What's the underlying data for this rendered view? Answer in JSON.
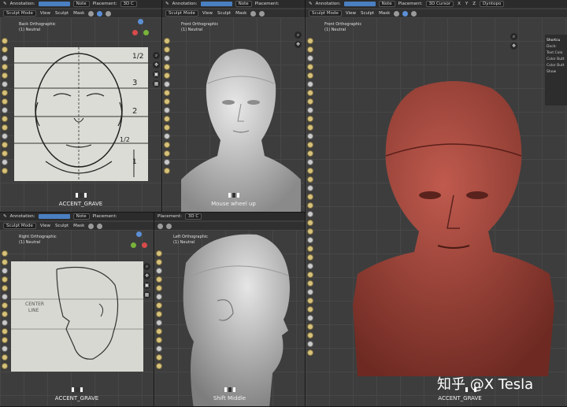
{
  "header": {
    "annotation_label": "Annotation:",
    "note_label": "Note",
    "placement_label": "Placement:",
    "placement_value": "3D Cursor",
    "placement_value_short": "3D C",
    "mode": "Sculpt Mode",
    "menu": [
      "View",
      "Sculpt",
      "Mask"
    ],
    "axis_x": "X",
    "axis_y": "Y",
    "axis_z": "Z",
    "dyntopo": "Dyntopo"
  },
  "viewports": {
    "back": {
      "ortho": "Back Orthographic",
      "collection": "(1) Neutral",
      "key": "ACCENT_GRAVE"
    },
    "front": {
      "ortho": "Front Orthographic",
      "collection": "(1) Neutral",
      "key": "Mouse wheel up"
    },
    "right": {
      "ortho": "Right Orthographic",
      "collection": "(1) Neutral",
      "key": "ACCENT_GRAVE"
    },
    "left": {
      "ortho": "Left Orthographic",
      "collection": "(1) Neutral",
      "key": "Shift Middle"
    },
    "main": {
      "ortho": "Front Orthographic",
      "collection": "(1) Neutral",
      "key": "ACCENT_GRAVE"
    }
  },
  "sketch": {
    "marks": [
      "1/2",
      "3",
      "2",
      "1/2",
      "1"
    ],
    "side_labels": [
      "CENTER",
      "LINE"
    ]
  },
  "npanel": {
    "title": "Shortcu",
    "dock": "Dock:",
    "text_color": "Text Colo",
    "color_button": "Color Butt",
    "color_button2": "Color Butt",
    "show": "Show"
  },
  "watermark": "知乎 @X Tesla",
  "colors": {
    "accent": "#4a7fc1",
    "sculpt_red": "#a6473c",
    "sculpt_gray": "#cfcfcf"
  }
}
